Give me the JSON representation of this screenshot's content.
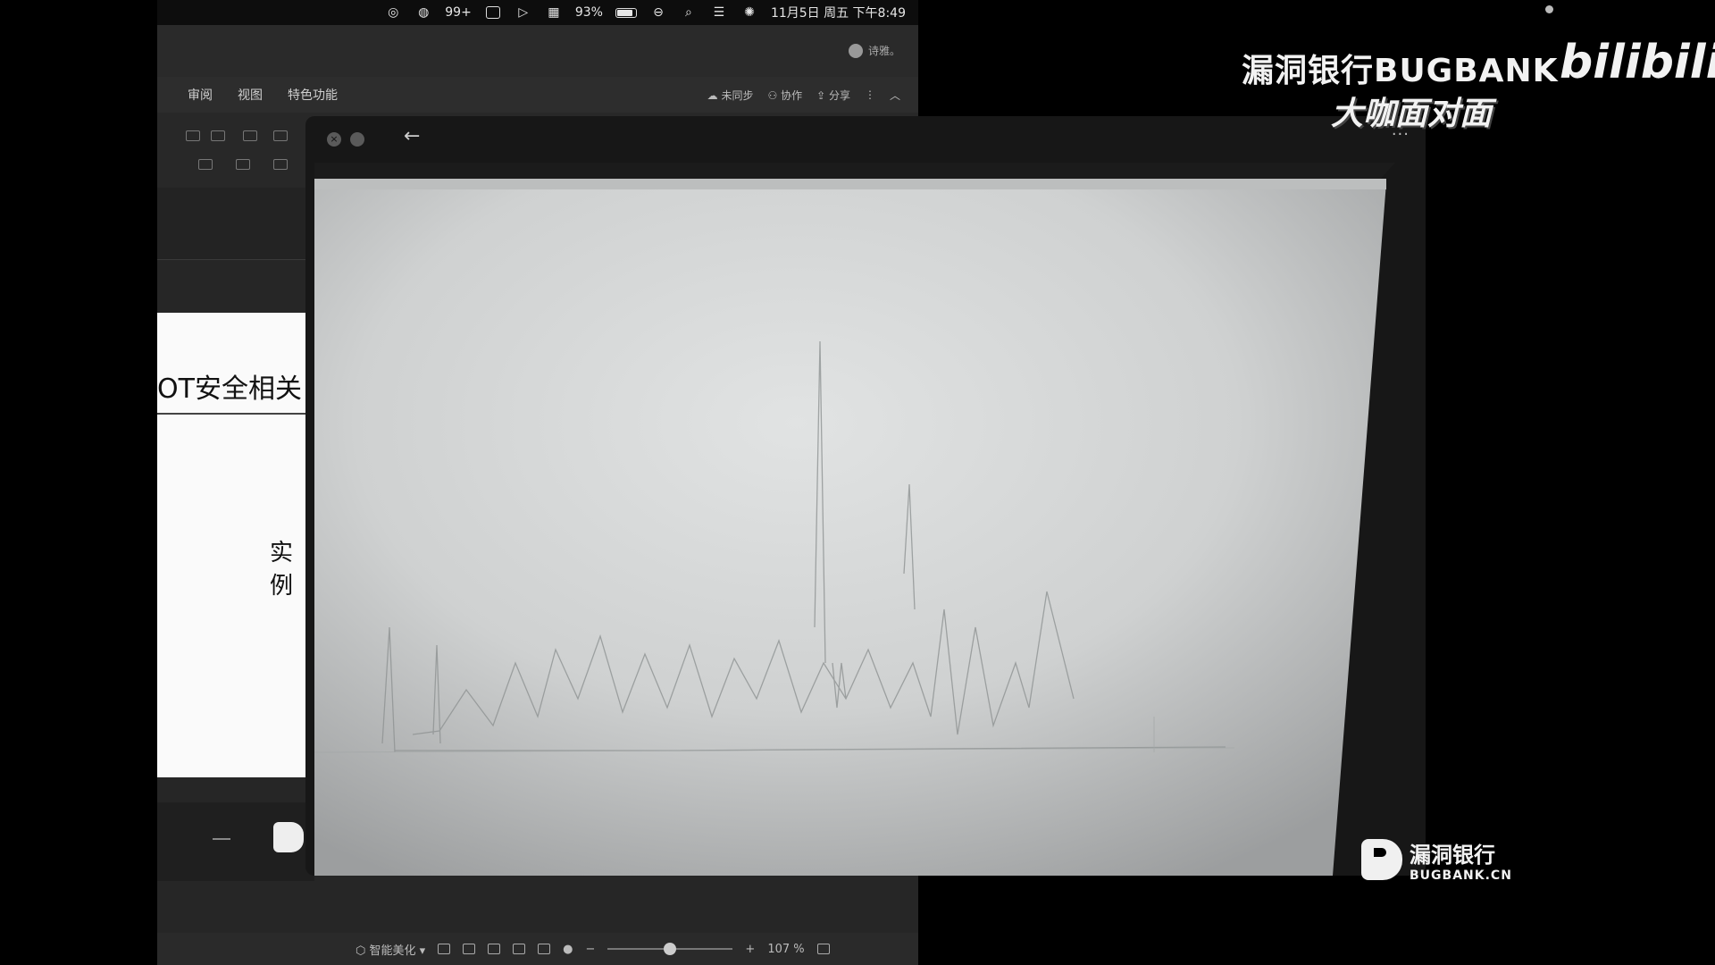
{
  "menubar": {
    "wechat_badge": "99+",
    "battery_percent": "93%",
    "battery_level": 0.93,
    "datetime": "11月5日 周五 下午8:49",
    "icons": [
      "creative-cloud-icon",
      "wechat-icon",
      "wps-icon",
      "play-icon",
      "grid-icon",
      "battery-icon",
      "link-icon",
      "search-icon",
      "control-center-icon",
      "siri-icon"
    ]
  },
  "app": {
    "user_label": "诗雅。",
    "ribbon_tabs": [
      "审阅",
      "视图",
      "特色功能"
    ],
    "ribbon_actions": {
      "unsynced": "未同步",
      "collaborate": "协作",
      "share": "分享"
    },
    "slide": {
      "title": "OT安全相关",
      "subtitle": "实例"
    },
    "statusbar": {
      "smart_beautify": "智能美化",
      "zoom_value": "107 %",
      "zoom_level": 0.5
    }
  },
  "viewer": {
    "back_symbol": "←",
    "more_symbol": "···",
    "close_symbol": "×"
  },
  "watermark": {
    "brand_title": "漏洞银行BUGBANK",
    "brand_sub": "大咖面对面",
    "bili": "bilibili",
    "corner_cn": "漏洞银行",
    "corner_en": "BUGBANK.CN"
  },
  "colors": {
    "app_bg": "#262626",
    "slide_bg": "#fafafa",
    "photo_bg": "#cfd0d0"
  }
}
